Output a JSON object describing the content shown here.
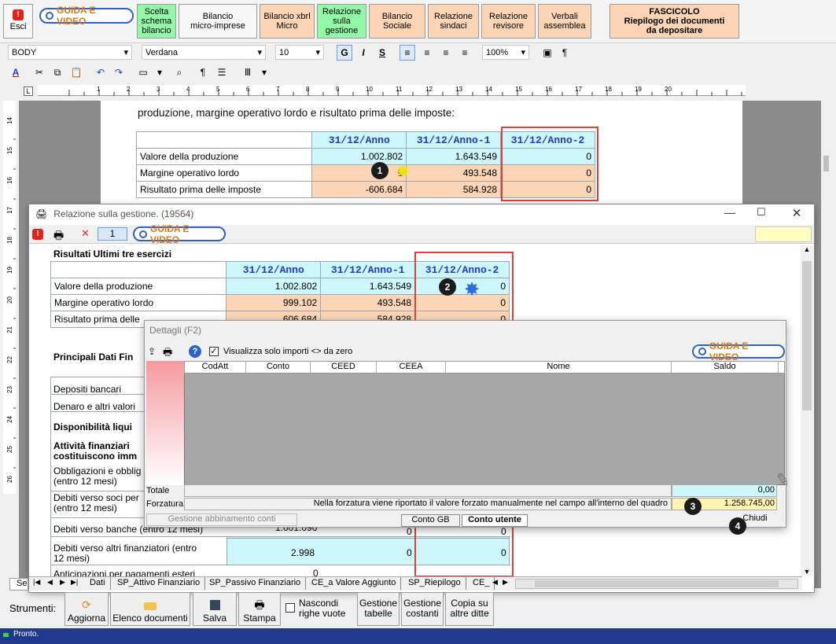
{
  "toolbar": {
    "esci": "Esci",
    "guida": "GUIDA E VIDEO",
    "buttons": [
      "Scelta\nschema\nbilancio",
      "Bilancio\nmicro-imprese",
      "Bilancio xbrl\nMicro",
      "Relazione\nsulla\ngestione",
      "Bilancio\nSociale",
      "Relazione\nsindaci",
      "Relazione\nrevisore",
      "Verbali\nassemblea"
    ],
    "fascicolo": "FASCICOLO\nRiepilogo dei documenti\nda depositare"
  },
  "format": {
    "style": "BODY",
    "font": "Verdana",
    "size": "10",
    "zoom": "100%",
    "bold": "G",
    "italic": "I",
    "strike": "S",
    "para": "¶"
  },
  "ruler": [
    "1",
    "2",
    "3",
    "4",
    "5",
    "6",
    "7",
    "8",
    "9",
    "10",
    "11",
    "12",
    "13",
    "14",
    "15",
    "16",
    "17",
    "18",
    "19",
    "20"
  ],
  "vruler": [
    "14",
    "15",
    "16",
    "17",
    "18",
    "19",
    "20",
    "21",
    "22",
    "23",
    "24",
    "25",
    "26"
  ],
  "doc": {
    "intro": "produzione, margine operativo lordo e risultato prima delle imposte:",
    "headers": [
      "31/12/Anno",
      "31/12/Anno-1",
      "31/12/Anno-2"
    ],
    "rows": [
      {
        "label": "Valore della produzione",
        "v": [
          "1.002.802",
          "1.643.549",
          "0"
        ]
      },
      {
        "label": "Margine operativo lordo",
        "v": [
          "9",
          "493.548",
          "0"
        ]
      },
      {
        "label": "Risultato prima delle imposte",
        "v": [
          "-606.684",
          "584.928",
          "0"
        ]
      }
    ]
  },
  "rel": {
    "title": "Relazione sulla gestione. (19564)",
    "page": "1",
    "guida": "GUIDA E VIDEO",
    "section": "Risultati Ultimi tre esercizi",
    "headers": [
      "31/12/Anno",
      "31/12/Anno-1",
      "31/12/Anno-2"
    ],
    "rows": [
      {
        "label": "Valore della produzione",
        "v": [
          "1.002.802",
          "1.643.549",
          "0"
        ]
      },
      {
        "label": "Margine operativo lordo",
        "v": [
          "999.102",
          "493.548",
          "0"
        ]
      },
      {
        "label": "Risultato prima delle",
        "v": [
          "606.684",
          "584.928",
          "0"
        ]
      }
    ],
    "left_labels": [
      "Principali Dati Fin",
      "Depositi bancari",
      "Denaro e altri valori",
      "Disponibilità liqui",
      "Attività finanziari",
      "costituiscono imm",
      "Obbligazioni e obblig",
      "(entro 12 mesi)",
      "Debiti verso soci per",
      "(entro 12 mesi)",
      "Debiti verso banche (entro 12 mesi)",
      "Debiti verso altri finanziatori (entro",
      "12 mesi)",
      "Anticipazioni per pagamenti esteri"
    ],
    "low_vals": {
      "banche": "1.001.096",
      "altri": "2.998",
      "zero": "0"
    }
  },
  "dettagli": {
    "title": "Dettagli (F2)",
    "check_label": "Visualizza solo importi <> da zero",
    "guida": "GUIDA E VIDEO",
    "cols": [
      "CodAtt",
      "Conto",
      "CEED",
      "CEEA",
      "Nome",
      "Saldo"
    ],
    "totale_label": "Totale",
    "totale": "0,00",
    "forzatura_label": "Forzatura",
    "forzatura_text": "Nella forzatura viene riportato il valore forzato manualmente nel campo all'interno del quadro",
    "forzatura_val": "1.258.745,00",
    "gestione": "Gestione abbinamento conti",
    "conto_gb": "Conto GB",
    "conto_utente": "Conto utente",
    "chiudi": "Chiudi"
  },
  "markers": [
    "1",
    "2",
    "3",
    "4"
  ],
  "tabs": [
    "Dati",
    "SP_Attivo Finanziario",
    "SP_Passivo Finanziario",
    "CE_a Valore Aggiunto",
    "SP_Riepilogo",
    "CE_"
  ],
  "tab_stub": "Se",
  "strumenti": {
    "label": "Strumenti:",
    "buttons": [
      "Aggiorna",
      "Elenco documenti",
      "Salva",
      "Stampa"
    ],
    "check": "Nascondi\nrighe vuote",
    "gest": [
      "Gestione\ntabelle",
      "Gestione\ncostanti",
      "Copia su\naltre ditte"
    ]
  },
  "status": "Pronto.",
  "colors": {
    "accent_blue": "#1b3cc9",
    "highlight_red": "#e0403a",
    "cyan": "#cdf7fb",
    "peach": "#fbd5b5",
    "green": "#92f9a8",
    "status_bar": "#1f3a8a"
  }
}
